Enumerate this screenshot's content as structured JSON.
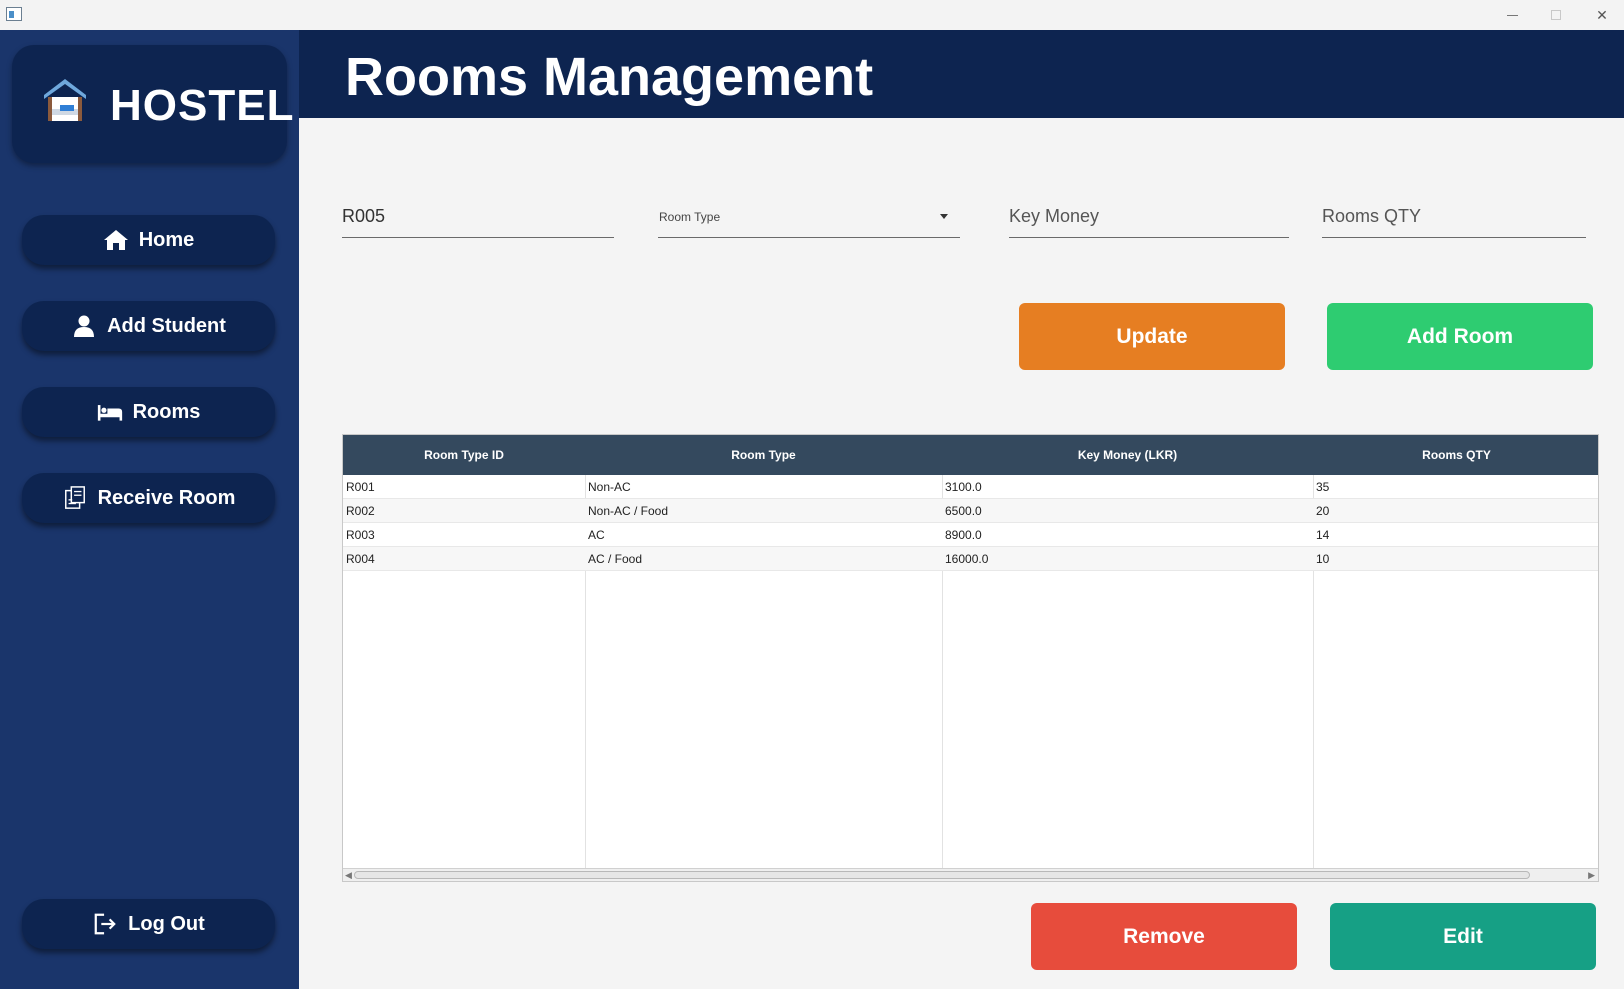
{
  "window": {
    "minimize_icon": "minimize-icon",
    "maximize_icon": "maximize-icon",
    "close_icon": "close-icon"
  },
  "sidebar": {
    "logo_text": "HOSTEL",
    "items": [
      {
        "label": "Home",
        "icon": "home-icon"
      },
      {
        "label": "Add Student",
        "icon": "user-icon"
      },
      {
        "label": "Rooms",
        "icon": "bed-icon"
      },
      {
        "label": "Receive Room",
        "icon": "receipt-icon"
      }
    ],
    "logout": {
      "label": "Log Out",
      "icon": "logout-icon"
    }
  },
  "header": {
    "title": "Rooms Management"
  },
  "form": {
    "room_type_id": {
      "value": "R005"
    },
    "room_type": {
      "label": "Room Type"
    },
    "key_money": {
      "placeholder": "Key Money"
    },
    "rooms_qty": {
      "placeholder": "Rooms QTY"
    }
  },
  "buttons": {
    "update": "Update",
    "add_room": "Add Room",
    "remove": "Remove",
    "edit": "Edit"
  },
  "table": {
    "headers": [
      "Room Type ID",
      "Room Type",
      "Key Money (LKR)",
      "Rooms QTY"
    ],
    "rows": [
      [
        "R001",
        "Non-AC",
        "3100.0",
        "35"
      ],
      [
        "R002",
        "Non-AC / Food",
        "6500.0",
        "20"
      ],
      [
        "R003",
        "AC",
        "8900.0",
        "14"
      ],
      [
        "R004",
        "AC / Food",
        "16000.0",
        "10"
      ]
    ]
  },
  "colors": {
    "sidebar_bg": "#1a356b",
    "header_bg": "#0d2450",
    "update": "#e67e22",
    "add_room": "#2ecc71",
    "remove": "#e74c3c",
    "edit": "#16a085",
    "table_header": "#34495e"
  }
}
